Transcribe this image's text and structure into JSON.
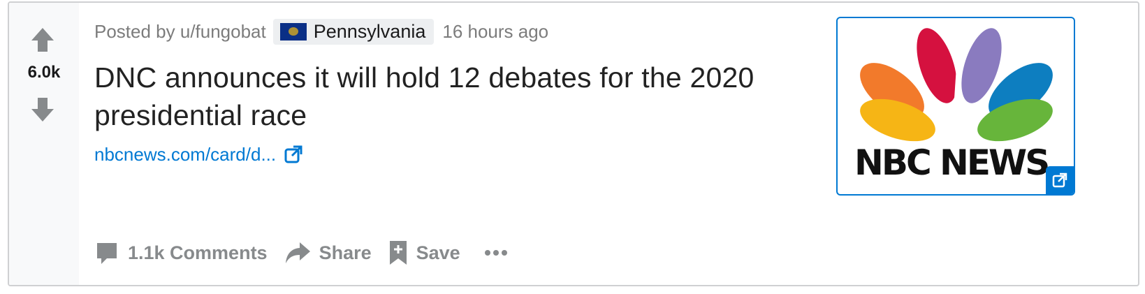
{
  "post": {
    "score": "6.0k",
    "posted_by": "Posted by u/fungobat",
    "flair": "Pennsylvania",
    "time": "16 hours ago",
    "title": "DNC announces it will hold 12 debates for the 2020 presidential race",
    "link_text": "nbcnews.com/card/d...",
    "thumbnail_text": "NBC NEWS"
  },
  "actions": {
    "comments": "1.1k Comments",
    "share": "Share",
    "save": "Save"
  },
  "colors": {
    "accent": "#0079d3",
    "muted": "#878a8c",
    "title": "#222222"
  },
  "icons": [
    "upvote-icon",
    "downvote-icon",
    "external-link-icon",
    "comment-icon",
    "share-icon",
    "save-icon",
    "more-icon",
    "nbc-peacock-logo"
  ]
}
